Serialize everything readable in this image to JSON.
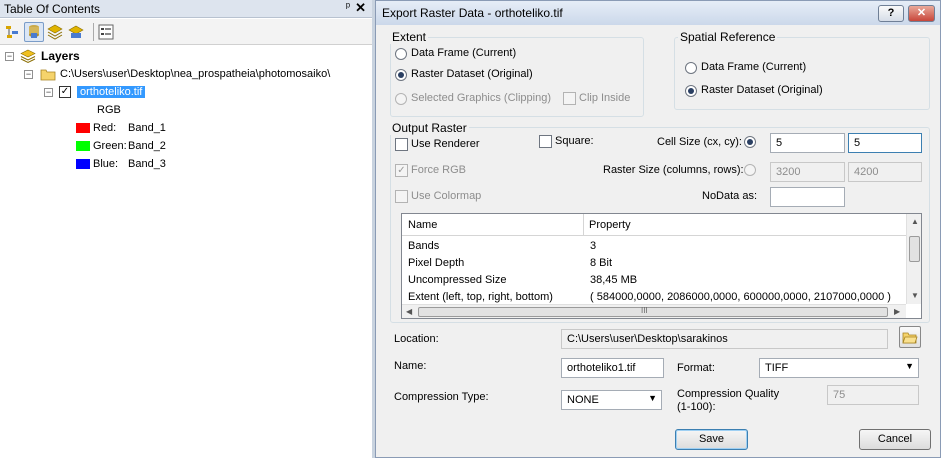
{
  "toc": {
    "title": "Table Of Contents",
    "pin_glyph": "ᵖ",
    "close_glyph": "✕",
    "toolbar": [
      "list-by-drawing-order-icon",
      "list-by-source-icon",
      "list-by-visibility-icon",
      "list-by-selection-icon",
      "options-icon"
    ],
    "tree": {
      "root_label": "Layers",
      "folder_path": "C:\\Users\\user\\Desktop\\nea_prospatheia\\photomosaiko\\",
      "layer_name": "orthoteliko.tif",
      "layer_checked": true,
      "render_type": "RGB",
      "bands": [
        {
          "channel": "Red:",
          "band": "Band_1",
          "color": "#ff0000"
        },
        {
          "channel": "Green:",
          "band": "Band_2",
          "color": "#00ff00"
        },
        {
          "channel": "Blue:",
          "band": "Band_3",
          "color": "#0000ff"
        }
      ]
    }
  },
  "dialog": {
    "title": "Export Raster Data - orthoteliko.tif",
    "help_glyph": "?",
    "close_glyph": "✕",
    "extent": {
      "title": "Extent",
      "data_frame": "Data Frame (Current)",
      "raster_dataset": "Raster Dataset (Original)",
      "selected_graphics": "Selected Graphics (Clipping)",
      "clip_inside": "Clip Inside"
    },
    "spatial_reference": {
      "title": "Spatial Reference",
      "data_frame": "Data Frame (Current)",
      "raster_dataset": "Raster Dataset (Original)"
    },
    "output_raster": {
      "title": "Output Raster",
      "use_renderer": "Use Renderer",
      "force_rgb": "Force RGB",
      "use_colormap": "Use Colormap",
      "square": "Square:",
      "cell_size_label": "Cell Size (cx, cy):",
      "cell_cx": "5",
      "cell_cy": "5",
      "raster_size_label": "Raster Size (columns, rows):",
      "columns": "3200",
      "rows": "4200",
      "nodata_label": "NoData as:",
      "nodata_value": ""
    },
    "properties": {
      "col_name": "Name",
      "col_property": "Property",
      "rows": [
        {
          "name": "Bands",
          "value": "3"
        },
        {
          "name": "Pixel Depth",
          "value": "8 Bit"
        },
        {
          "name": "Uncompressed Size",
          "value": "38,45 MB"
        },
        {
          "name": "Extent (left, top, right, bottom)",
          "value": "( 584000,0000, 2086000,0000, 600000,0000, 2107000,0000 )"
        }
      ],
      "hscroll_grip": "III"
    },
    "location_label": "Location:",
    "location_value": "C:\\Users\\user\\Desktop\\sarakinos",
    "name_label": "Name:",
    "name_value": "orthoteliko1.tif",
    "format_label": "Format:",
    "format_value": "TIFF",
    "compression_type_label": "Compression Type:",
    "compression_type_value": "NONE",
    "compression_quality_label_1": "Compression Quality",
    "compression_quality_label_2": "(1-100):",
    "compression_quality_value": "75",
    "save_label": "Save",
    "cancel_label": "Cancel"
  }
}
